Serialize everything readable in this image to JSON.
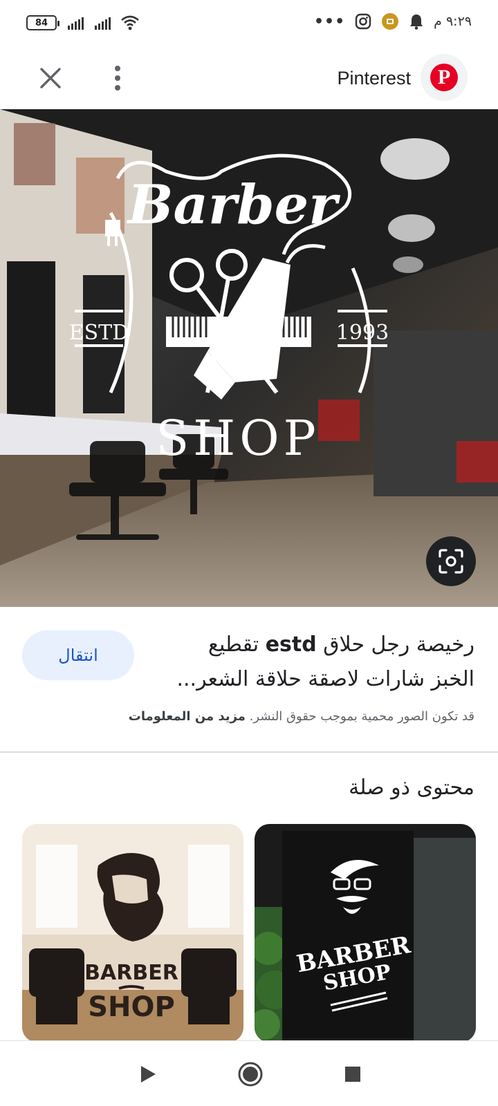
{
  "status_bar": {
    "battery": "84",
    "time": "٩:٢٩ م",
    "overflow": "•••"
  },
  "app_bar": {
    "source_name": "Pinterest",
    "logo_letter": "P"
  },
  "main_image": {
    "logo_top": "Barber",
    "logo_left": "ESTD",
    "logo_right": "1993",
    "logo_bottom": "SHOP"
  },
  "result": {
    "title_prefix": "رخيصة رجل حلاق",
    "title_bold": "estd",
    "title_rest": "تقطيع الخبز شارات لاصقة حلاقة الشعر...",
    "visit_button": "انتقال",
    "copyright_note": "قد تكون الصور محمية بموجب حقوق النشر.",
    "more_info": "مزيد من المعلومات"
  },
  "related": {
    "heading": "محتوى ذو صلة",
    "cards": [
      {
        "line1": "BARBER",
        "line2": "SHOP"
      },
      {
        "line1": "BARBER",
        "line2": "SHOP"
      }
    ]
  },
  "colors": {
    "accent_blue": "#1a57c7",
    "chip_bg": "#e8f0fe",
    "pinterest_red": "#e60023"
  },
  "icons": [
    "battery-icon",
    "signal-icon",
    "wifi-icon",
    "instagram-icon",
    "notification-icon",
    "bell-icon",
    "close-icon",
    "more-vert-icon",
    "pinterest-logo",
    "lens-icon",
    "back-icon",
    "home-icon",
    "recents-icon"
  ]
}
